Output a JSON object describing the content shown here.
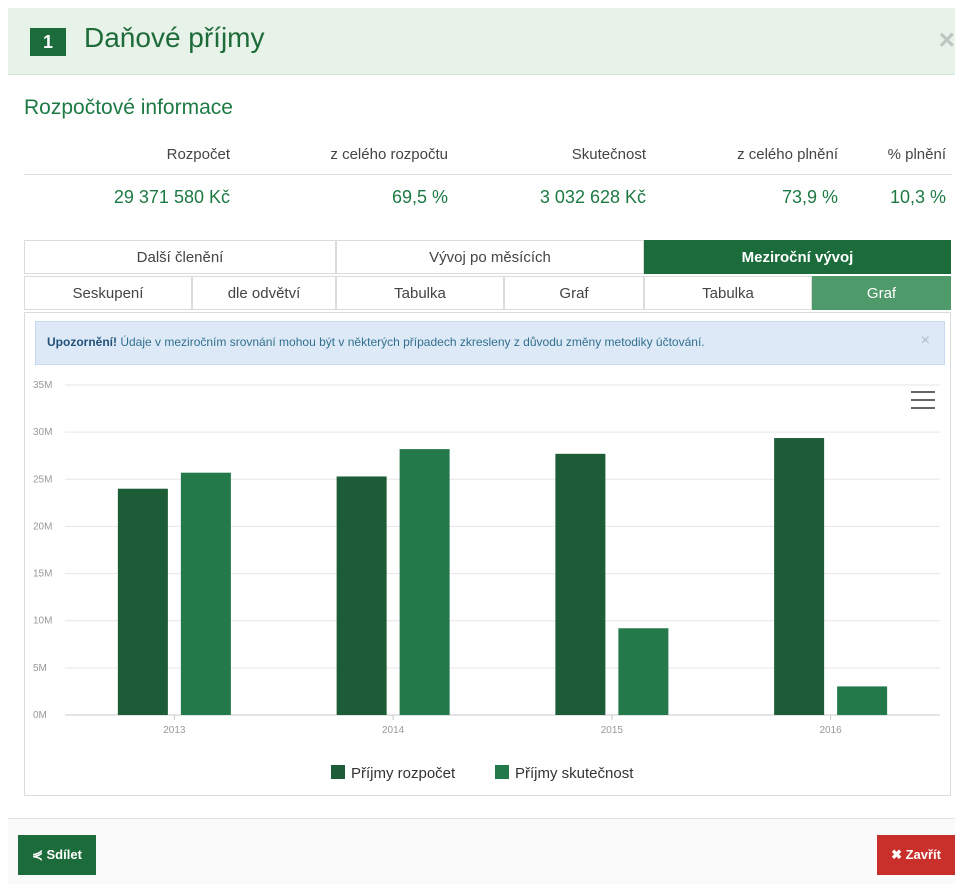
{
  "header": {
    "number": "1",
    "title": "Daňové příjmy",
    "close_glyph": "×"
  },
  "section_title": "Rozpočtové informace",
  "budget": {
    "headers": [
      "Rozpočet",
      "z celého rozpočtu",
      "Skutečnost",
      "z celého plnění",
      "% plnění"
    ],
    "values": [
      "29 371 580 Kč",
      "69,5 %",
      "3 032 628 Kč",
      "73,9 %",
      "10,3 %"
    ]
  },
  "tabs": {
    "row1": [
      "Další členění",
      "Vývoj po měsících",
      "Meziroční vývoj"
    ],
    "row2": [
      "Seskupení",
      "dle odvětví",
      "Tabulka",
      "Graf",
      "Tabulka",
      "Graf"
    ]
  },
  "alert": {
    "strong": "Upozornění!",
    "text": " Údaje v meziročním srovnání mohou být v některých případech zkresleny z důvodu změny metodiky účtování.",
    "close_glyph": "×"
  },
  "chart_data": {
    "type": "bar",
    "categories": [
      "2013",
      "2014",
      "2015",
      "2016"
    ],
    "series": [
      {
        "name": "Příjmy rozpočet",
        "values": [
          24000000,
          25300000,
          27700000,
          29371580
        ],
        "color": "#1c5c37"
      },
      {
        "name": "Příjmy skutečnost",
        "values": [
          25700000,
          28200000,
          9200000,
          3032628
        ],
        "color": "#23794a"
      }
    ],
    "y_ticks": [
      "0M",
      "5M",
      "10M",
      "15M",
      "20M",
      "25M",
      "30M",
      "35M"
    ],
    "ylim": [
      0,
      35000000
    ],
    "grid": true,
    "legend": "bottom-center"
  },
  "footer": {
    "share_label": "Sdílet",
    "close_label": "Zavřít",
    "share_icon": "share-icon",
    "close_icon": "close-icon"
  },
  "colors": {
    "accent": "#1c6b3a",
    "text_green": "#1e7a45",
    "danger": "#c9302c"
  }
}
